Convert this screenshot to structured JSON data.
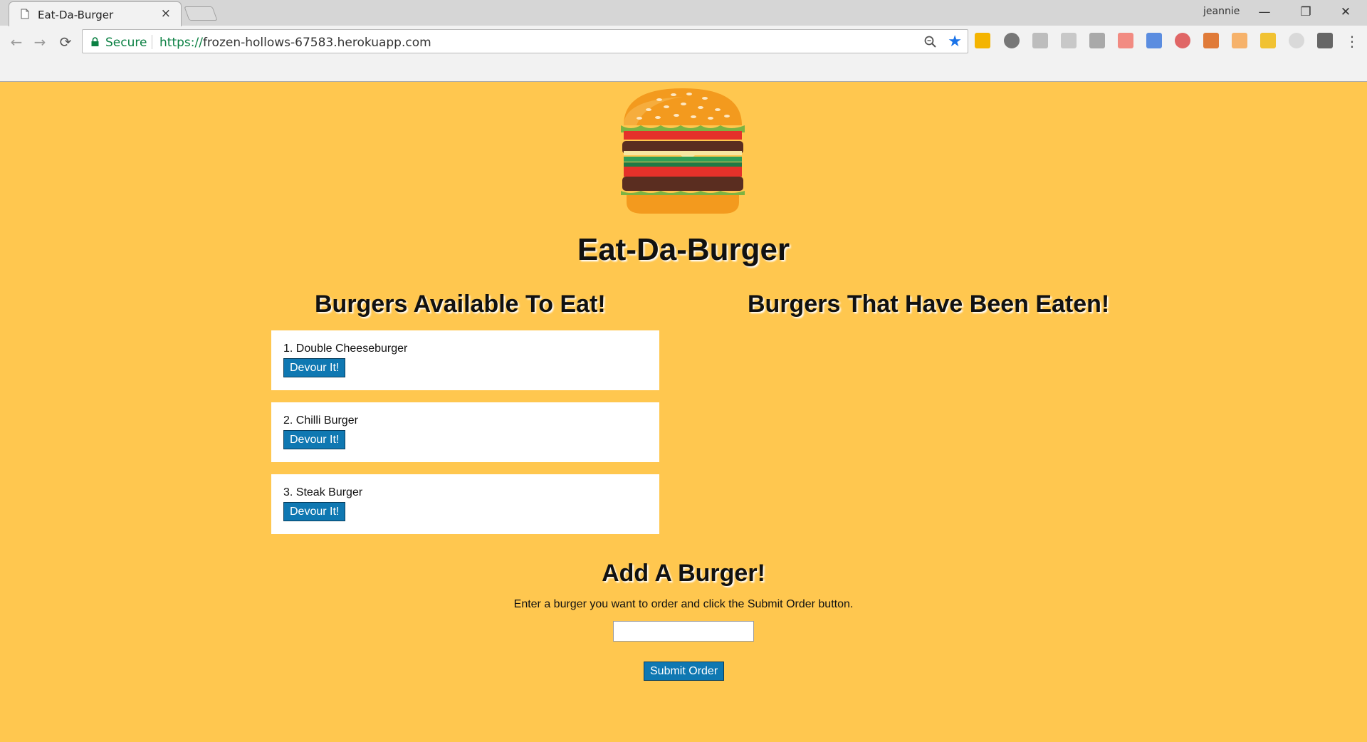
{
  "browser": {
    "tab_title": "Eat-Da-Burger",
    "tab_close": "×",
    "profile_name": "jeannie",
    "window_controls": {
      "minimize": "—",
      "restore": "❐",
      "close": "✕"
    },
    "nav": {
      "back": "←",
      "forward": "→",
      "reload": "⟳"
    },
    "secure_label": "Secure",
    "url_scheme": "https://",
    "url_host": "frozen-hollows-67583.herokuapp.com",
    "star": "★",
    "menu": "⋮",
    "extension_icons": [
      "ext-yellow-icon",
      "ext-timer-icon",
      "ext-g-icon",
      "ext-pdf-icon",
      "ext-s-icon",
      "ext-arrow-icon",
      "ext-doc-icon",
      "ext-color-wheel-icon",
      "ext-hammer-icon",
      "ext-pencil-icon",
      "ext-diamond-icon",
      "ext-brackets-icon",
      "ext-note-icon"
    ]
  },
  "page": {
    "title": "Eat-Da-Burger",
    "available_heading": "Burgers Available To Eat!",
    "eaten_heading": "Burgers That Have Been Eaten!",
    "burgers": [
      {
        "name": "1. Double Cheeseburger",
        "button": "Devour It!"
      },
      {
        "name": "2. Chilli Burger",
        "button": "Devour It!"
      },
      {
        "name": "3. Steak Burger",
        "button": "Devour It!"
      }
    ],
    "add_heading": "Add A Burger!",
    "add_instructions": "Enter a burger you want to order and click the Submit Order button.",
    "input_value": "",
    "submit_label": "Submit Order"
  },
  "colors": {
    "page_background": "#ffc74f",
    "button_blue": "#0f78b2",
    "secure_green": "#0b8043"
  }
}
